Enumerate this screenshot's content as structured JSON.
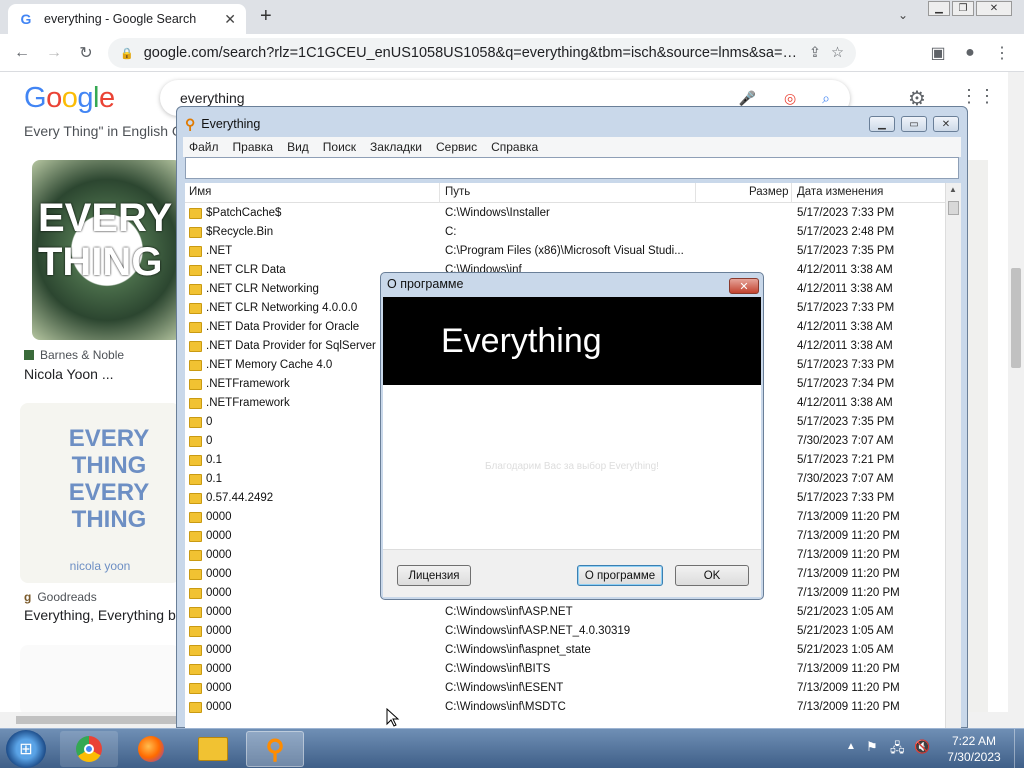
{
  "browser": {
    "tab_title": "everything - Google Search",
    "url": "google.com/search?rlz=1C1GCEU_enUS1058US1058&q=everything&tbm=isch&source=lnms&sa=X&ved=2ah..."
  },
  "google": {
    "logo": "Google",
    "query": "everything",
    "results": [
      {
        "source": "Barnes & Noble",
        "title": "Nicola Yoon ..."
      },
      {
        "source": "Goodreads",
        "title": "Everything, Everything b"
      }
    ],
    "snippet": "Every Thing\" in English G",
    "book1_text": "EVERY THING",
    "book2_text": "EVERY THING EVERY THING",
    "book2_author": "nicola yoon"
  },
  "everything_app": {
    "title": "Everything",
    "menu": [
      "Файл",
      "Правка",
      "Вид",
      "Поиск",
      "Закладки",
      "Сервис",
      "Справка"
    ],
    "columns": {
      "name": "Имя",
      "path": "Путь",
      "size": "Размер",
      "modified": "Дата изменения"
    },
    "rows": [
      {
        "name": "$PatchCache$",
        "path": "C:\\Windows\\Installer",
        "date": "5/17/2023 7:33 PM"
      },
      {
        "name": "$Recycle.Bin",
        "path": "C:",
        "date": "5/17/2023 2:48 PM"
      },
      {
        "name": ".NET",
        "path": "C:\\Program Files (x86)\\Microsoft Visual Studi...",
        "date": "5/17/2023 7:35 PM"
      },
      {
        "name": ".NET CLR Data",
        "path": "C:\\Windows\\inf",
        "date": "4/12/2011 3:38 AM"
      },
      {
        "name": ".NET CLR Networking",
        "path": "",
        "date": "4/12/2011 3:38 AM"
      },
      {
        "name": ".NET CLR Networking 4.0.0.0",
        "path": "",
        "date": "5/17/2023 7:33 PM"
      },
      {
        "name": ".NET Data Provider for Oracle",
        "path": "",
        "date": "4/12/2011 3:38 AM"
      },
      {
        "name": ".NET Data Provider for SqlServer",
        "path": "",
        "date": "4/12/2011 3:38 AM"
      },
      {
        "name": ".NET Memory Cache 4.0",
        "path": "",
        "date": "5/17/2023 7:33 PM"
      },
      {
        "name": ".NETFramework",
        "path": "",
        "date": "5/17/2023 7:34 PM"
      },
      {
        "name": ".NETFramework",
        "path": "",
        "date": "4/12/2011 3:38 AM"
      },
      {
        "name": "0",
        "path": "",
        "date": "5/17/2023 7:35 PM"
      },
      {
        "name": "0",
        "path": "",
        "date": "7/30/2023 7:07 AM"
      },
      {
        "name": "0.1",
        "path": "",
        "date": "5/17/2023 7:21 PM"
      },
      {
        "name": "0.1",
        "path": "",
        "date": "7/30/2023 7:07 AM"
      },
      {
        "name": "0.57.44.2492",
        "path": "",
        "date": "5/17/2023 7:33 PM"
      },
      {
        "name": "0000",
        "path": "",
        "date": "7/13/2009 11:20 PM"
      },
      {
        "name": "0000",
        "path": "",
        "date": "7/13/2009 11:20 PM"
      },
      {
        "name": "0000",
        "path": "",
        "date": "7/13/2009 11:20 PM"
      },
      {
        "name": "0000",
        "path": "",
        "date": "7/13/2009 11:20 PM"
      },
      {
        "name": "0000",
        "path": "",
        "date": "7/13/2009 11:20 PM"
      },
      {
        "name": "0000",
        "path": "C:\\Windows\\inf\\ASP.NET",
        "date": "5/21/2023 1:05 AM"
      },
      {
        "name": "0000",
        "path": "C:\\Windows\\inf\\ASP.NET_4.0.30319",
        "date": "5/21/2023 1:05 AM"
      },
      {
        "name": "0000",
        "path": "C:\\Windows\\inf\\aspnet_state",
        "date": "5/21/2023 1:05 AM"
      },
      {
        "name": "0000",
        "path": "C:\\Windows\\inf\\BITS",
        "date": "7/13/2009 11:20 PM"
      },
      {
        "name": "0000",
        "path": "C:\\Windows\\inf\\ESENT",
        "date": "7/13/2009 11:20 PM"
      },
      {
        "name": "0000",
        "path": "C:\\Windows\\inf\\MSDTC",
        "date": "7/13/2009 11:20 PM"
      }
    ]
  },
  "about_dialog": {
    "title": "О программе",
    "banner": "Everything",
    "thanks": "Благодарим Вас за выбор Everything!",
    "buttons": {
      "license": "Лицензия",
      "about": "О программе",
      "ok": "OK"
    }
  },
  "taskbar": {
    "time": "7:22 AM",
    "date": "7/30/2023"
  },
  "colors": {
    "google_blue": "#4285f4",
    "google_red": "#ea4335",
    "google_yellow": "#fbbc05",
    "google_green": "#34a853"
  }
}
